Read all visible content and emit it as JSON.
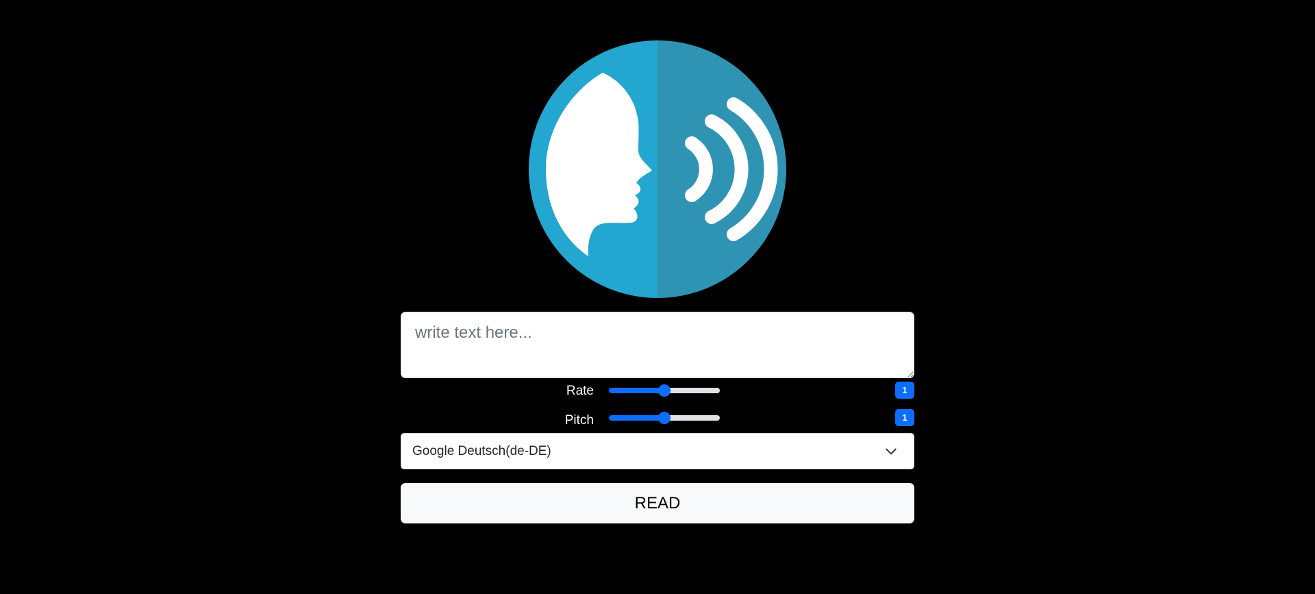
{
  "logo": {
    "icon": "speaking-head-icon",
    "colors": {
      "left_half": "#23a6cf",
      "right_half": "#2f94b3",
      "foreground": "#ffffff"
    }
  },
  "text_input": {
    "placeholder": "write text here...",
    "value": ""
  },
  "rate": {
    "label": "Rate",
    "value": "1",
    "slider_fraction": 0.5
  },
  "pitch": {
    "label": "Pitch",
    "value": "1",
    "slider_fraction": 0.5
  },
  "voice_select": {
    "selected": "Google Deutsch(de-DE)",
    "icon": "chevron-down-icon"
  },
  "read_button": {
    "label": "READ"
  },
  "colors": {
    "background": "#000000",
    "accent": "#0d6efd"
  }
}
